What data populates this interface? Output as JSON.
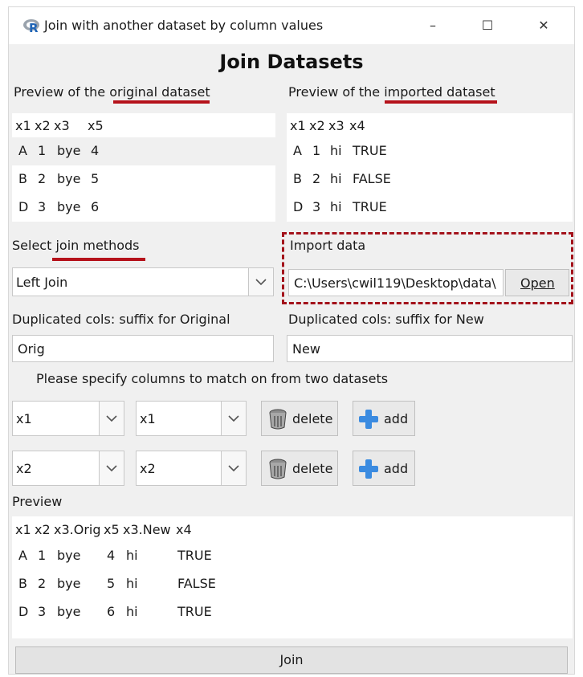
{
  "window": {
    "title": "Join with another dataset by column values",
    "icon": "r-logo-icon",
    "controls": {
      "minimize": "–",
      "maximize": "☐",
      "close": "✕"
    }
  },
  "heading": "Join Datasets",
  "original": {
    "label_prefix": "Preview of the ",
    "label_underlined": "original dataset",
    "columns": [
      "x1",
      "x2",
      "x3",
      "x5"
    ],
    "rows": [
      [
        "A",
        "1",
        "bye",
        "4"
      ],
      [
        "B",
        "2",
        "bye",
        "5"
      ],
      [
        "D",
        "3",
        "bye",
        "6"
      ]
    ]
  },
  "imported": {
    "label_prefix": "Preview of the ",
    "label_underlined": "imported dataset",
    "columns": [
      "x1",
      "x2",
      "x3",
      "x4"
    ],
    "rows": [
      [
        "A",
        "1",
        "hi",
        "TRUE"
      ],
      [
        "B",
        "2",
        "hi",
        "FALSE"
      ],
      [
        "D",
        "3",
        "hi",
        "TRUE"
      ]
    ]
  },
  "join_method": {
    "label_prefix": "Select ",
    "label_underlined": "join methods",
    "selected": "Left Join"
  },
  "import_data": {
    "label": "Import data",
    "path": "C:\\Users\\cwil119\\Desktop\\data\\",
    "open_button": "Open"
  },
  "suffix": {
    "original_label": "Duplicated cols: suffix for Original",
    "original_value": "Orig",
    "new_label": "Duplicated cols: suffix for New",
    "new_value": "New"
  },
  "match": {
    "instruction": "Please specify columns to match on from two datasets",
    "pairs": [
      {
        "left": "x1",
        "right": "x1",
        "delete_label": "delete",
        "add_label": "add"
      },
      {
        "left": "x2",
        "right": "x2",
        "delete_label": "delete",
        "add_label": "add"
      }
    ]
  },
  "preview": {
    "label": "Preview",
    "columns": [
      "x1",
      "x2",
      "x3.Orig",
      "x5",
      "x3.New",
      "x4"
    ],
    "rows": [
      [
        "A",
        "1",
        "bye",
        "4",
        "hi",
        "TRUE"
      ],
      [
        "B",
        "2",
        "bye",
        "5",
        "hi",
        "FALSE"
      ],
      [
        "D",
        "3",
        "bye",
        "6",
        "hi",
        "TRUE"
      ]
    ]
  },
  "join_button": "Join",
  "colors": {
    "annotation": "#b5121b",
    "window_bg": "#f0f0f0",
    "r_logo": "#2165b6"
  }
}
